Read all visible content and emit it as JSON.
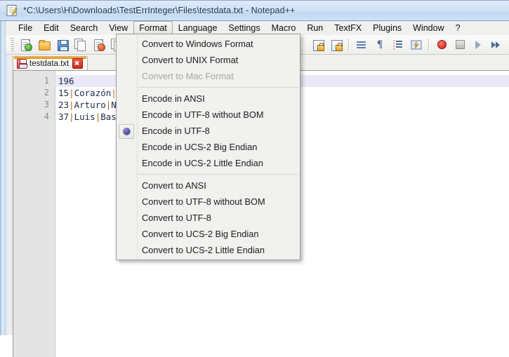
{
  "window": {
    "title": "*C:\\Users\\H\\Downloads\\TestErrInteger\\Files\\testdata.txt - Notepad++",
    "app_icon": "notepad-plus-plus-icon"
  },
  "menubar": {
    "items": [
      {
        "label": "File",
        "accel": "F",
        "active": false
      },
      {
        "label": "Edit",
        "accel": "E",
        "active": false
      },
      {
        "label": "Search",
        "accel": "S",
        "active": false
      },
      {
        "label": "View",
        "accel": "V",
        "active": false
      },
      {
        "label": "Format",
        "accel": "m",
        "active": true
      },
      {
        "label": "Language",
        "accel": "L",
        "active": false
      },
      {
        "label": "Settings",
        "accel": "t",
        "active": false
      },
      {
        "label": "Macro",
        "accel": "",
        "active": false
      },
      {
        "label": "Run",
        "accel": "",
        "active": false
      },
      {
        "label": "TextFX",
        "accel": "",
        "active": false
      },
      {
        "label": "Plugins",
        "accel": "",
        "active": false
      },
      {
        "label": "Window",
        "accel": "W",
        "active": false
      },
      {
        "label": "?",
        "accel": "",
        "active": false
      }
    ]
  },
  "toolbar": {
    "buttons": [
      {
        "name": "new-file-button",
        "icon": "new-file-icon"
      },
      {
        "name": "open-file-button",
        "icon": "open-folder-icon"
      },
      {
        "name": "save-button",
        "icon": "save-floppy-icon"
      },
      {
        "name": "save-all-button",
        "icon": "save-all-icon"
      },
      {
        "name": "close-button",
        "icon": "close-file-icon"
      },
      {
        "name": "close-all-button",
        "icon": "close-all-files-icon"
      },
      {
        "name": "zoom-in-button",
        "icon": "zoom-in-icon"
      },
      {
        "name": "zoom-out-button",
        "icon": "zoom-out-icon"
      },
      {
        "name": "word-wrap-button",
        "icon": "word-wrap-icon"
      },
      {
        "name": "show-all-chars-button",
        "icon": "pilcrow-icon"
      },
      {
        "name": "indent-guide-button",
        "icon": "indent-guide-icon"
      },
      {
        "name": "show-uri-button",
        "icon": "uri-highlight-icon"
      },
      {
        "name": "start-record-button",
        "icon": "record-macro-icon"
      },
      {
        "name": "stop-record-button",
        "icon": "stop-macro-icon"
      },
      {
        "name": "play-macro-button",
        "icon": "play-macro-icon"
      },
      {
        "name": "run-multiple-button",
        "icon": "fast-forward-icon"
      },
      {
        "name": "save-macro-button",
        "icon": "macro-list-icon"
      },
      {
        "name": "run-button",
        "icon": "run-folder-icon"
      }
    ]
  },
  "tabs": [
    {
      "label": "testdata.txt",
      "icon": "unsaved-floppy-icon",
      "modified": true,
      "active": true
    }
  ],
  "editor": {
    "lines": [
      {
        "number": "1",
        "text": "196",
        "current": true
      },
      {
        "number": "2",
        "text": "15|Corazón|",
        "current": false
      },
      {
        "number": "3",
        "text": "23|Arturo|N",
        "current": false
      },
      {
        "number": "4",
        "text": "37|Luis|Bas",
        "current": false
      }
    ]
  },
  "format_menu": {
    "groups": [
      {
        "items": [
          {
            "label": "Convert to Windows Format",
            "disabled": false,
            "checked": false
          },
          {
            "label": "Convert to UNIX Format",
            "disabled": false,
            "checked": false
          },
          {
            "label": "Convert to Mac Format",
            "disabled": true,
            "checked": false
          }
        ]
      },
      {
        "items": [
          {
            "label": "Encode in ANSI",
            "disabled": false,
            "checked": false
          },
          {
            "label": "Encode in UTF-8 without BOM",
            "disabled": false,
            "checked": false
          },
          {
            "label": "Encode in UTF-8",
            "disabled": false,
            "checked": true
          },
          {
            "label": "Encode in UCS-2 Big Endian",
            "disabled": false,
            "checked": false
          },
          {
            "label": "Encode in UCS-2 Little Endian",
            "disabled": false,
            "checked": false
          }
        ]
      },
      {
        "items": [
          {
            "label": "Convert to ANSI",
            "disabled": false,
            "checked": false
          },
          {
            "label": "Convert to UTF-8 without BOM",
            "disabled": false,
            "checked": false
          },
          {
            "label": "Convert to UTF-8",
            "disabled": false,
            "checked": false
          },
          {
            "label": "Convert to UCS-2 Big Endian",
            "disabled": false,
            "checked": false
          },
          {
            "label": "Convert to UCS-2 Little Endian",
            "disabled": false,
            "checked": false
          }
        ]
      }
    ]
  },
  "colors": {
    "title_bar": "#cfe0f4",
    "menu_bg": "#f0f0ee",
    "dropdown_bg": "#f1f1ef",
    "tab_accent": "#ef8d0b",
    "current_line": "#e9e9f8",
    "code_text": "#1b2a4a",
    "pipe_operator": "#b06a18",
    "gutter_bg": "#e4e4e4",
    "radio_dot": "#5a5ab4"
  }
}
